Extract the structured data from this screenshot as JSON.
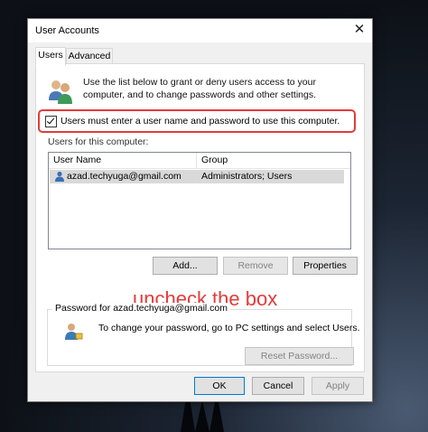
{
  "window": {
    "title": "User Accounts"
  },
  "tabs": [
    {
      "label": "Users",
      "active": true
    },
    {
      "label": "Advanced",
      "active": false
    }
  ],
  "intro_text": "Use the list below to grant or deny users access to your computer, and to change passwords and other settings.",
  "checkbox": {
    "label": "Users must enter a user name and password to use this computer.",
    "checked": true
  },
  "users_section_label": "Users for this computer:",
  "table": {
    "columns": [
      "User Name",
      "Group"
    ],
    "rows": [
      {
        "user": "azad.techyuga@gmail.com",
        "group": "Administrators; Users",
        "selected": true
      }
    ]
  },
  "annotation": "uncheck the box",
  "buttons": {
    "add": "Add...",
    "remove": "Remove",
    "properties": "Properties",
    "reset_password": "Reset Password...",
    "ok": "OK",
    "cancel": "Cancel",
    "apply": "Apply"
  },
  "password_group": {
    "title": "Password for azad.techyuga@gmail.com",
    "text": "To change your password, go to PC settings and select Users."
  },
  "colors": {
    "annotation": "#e53b3b",
    "selection": "#d9d9d9",
    "default_button_border": "#0078d7"
  },
  "icons": [
    "close-icon",
    "users-group-icon",
    "user-icon",
    "user-password-icon"
  ]
}
